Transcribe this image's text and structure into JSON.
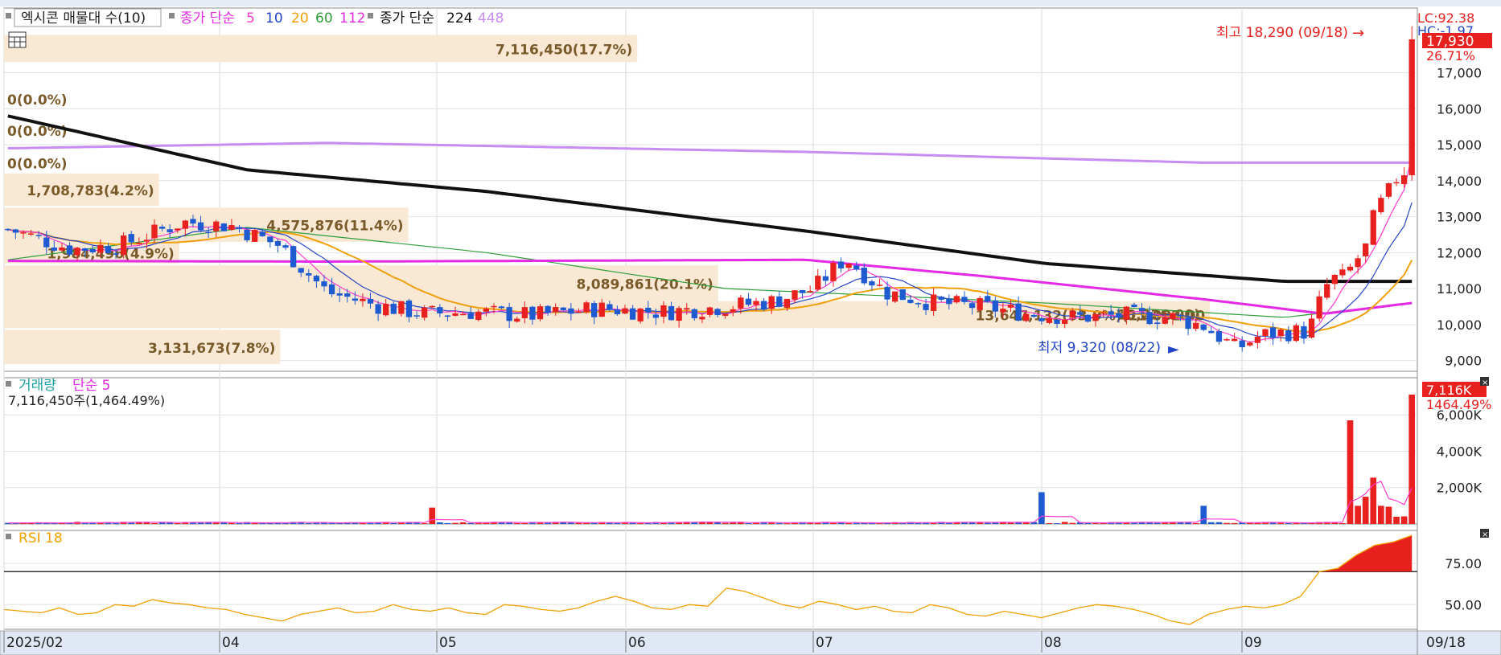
{
  "legend": {
    "main_box": "엑시콘 매물대 수(10)",
    "ma_prefix": "종가 단순",
    "ma_periods": [
      "5",
      "10",
      "20",
      "60",
      "112"
    ],
    "ma_long_prefix": "종가 단순",
    "ma_long_periods": [
      "224",
      "448"
    ],
    "volume_title": "거래량",
    "volume_ma": "단순 5",
    "volume_summary": "7,116,450주(1,464.49%)",
    "rsi_title": "RSI 18"
  },
  "right_labels": {
    "lc": "LC:92.38",
    "hc": "HC:-1.97",
    "last_price": "17,930",
    "change_pct": "26.71%",
    "vol_last": "7,116K",
    "vol_pct": "1464.49%",
    "date_last": "09/18"
  },
  "markers": {
    "high": "최고 18,290 (09/18)",
    "low": "최저 9,320 (08/22)"
  },
  "colors": {
    "up": "#e8201e",
    "down": "#1e5ad0",
    "ma5": "#ff3cd2",
    "ma10": "#2345c8",
    "ma20": "#f0a00a",
    "ma60": "#2e9e3a",
    "ma112": "#e42ae4",
    "ma224": "#111111",
    "ma448": "#c88cf5",
    "profile": "#f8e8d4",
    "profile_text": "#7a5a28",
    "rsi": "#f0a000"
  },
  "chart_data": [
    {
      "type": "candlestick",
      "title": "엑시콘",
      "x_ticks": [
        "2025/02",
        "04",
        "05",
        "06",
        "07",
        "08",
        "09"
      ],
      "ylim": [
        8700,
        18800
      ],
      "y_ticks": [
        9000,
        10000,
        11000,
        12000,
        13000,
        14000,
        15000,
        16000,
        17000
      ],
      "y_tick_labels": [
        "9,000",
        "10,000",
        "11,000",
        "12,000",
        "13,000",
        "14,000",
        "15,000",
        "16,000",
        "17,000"
      ],
      "n_days": 154,
      "key_prices": [
        {
          "day": 0,
          "close": 12650
        },
        {
          "day": 8,
          "close": 12100
        },
        {
          "day": 14,
          "close": 12200
        },
        {
          "day": 22,
          "close": 12850
        },
        {
          "day": 28,
          "close": 12750
        },
        {
          "day": 34,
          "close": 12200
        },
        {
          "day": 40,
          "close": 10900
        },
        {
          "day": 46,
          "close": 10550
        },
        {
          "day": 52,
          "close": 10300
        },
        {
          "day": 58,
          "close": 10350
        },
        {
          "day": 66,
          "close": 10250
        },
        {
          "day": 74,
          "close": 10450
        },
        {
          "day": 82,
          "close": 10350
        },
        {
          "day": 90,
          "close": 10500
        },
        {
          "day": 96,
          "close": 10650
        },
        {
          "day": 101,
          "close": 11000
        },
        {
          "day": 105,
          "close": 11850
        },
        {
          "day": 110,
          "close": 10900
        },
        {
          "day": 116,
          "close": 10600
        },
        {
          "day": 122,
          "close": 10500
        },
        {
          "day": 128,
          "close": 10300
        },
        {
          "day": 134,
          "close": 10200
        },
        {
          "day": 140,
          "close": 10250
        },
        {
          "day": 146,
          "close": 10200
        },
        {
          "day": 150,
          "close": 9950
        },
        {
          "day": 154,
          "close": 9320
        },
        {
          "day": 157,
          "close": 9700
        },
        {
          "day": 160,
          "close": 9780
        },
        {
          "day": 163,
          "close": 9800
        },
        {
          "day": 164,
          "close": 10500
        },
        {
          "day": 165,
          "close": 11000
        },
        {
          "day": 166,
          "close": 11300
        },
        {
          "day": 167,
          "close": 11400
        },
        {
          "day": 168,
          "close": 11500
        },
        {
          "day": 169,
          "close": 11800
        },
        {
          "day": 170,
          "close": 12000
        },
        {
          "day": 171,
          "close": 13000
        },
        {
          "day": 172,
          "close": 13400
        },
        {
          "day": 173,
          "close": 13800
        },
        {
          "day": 174,
          "close": 14000
        },
        {
          "day": 175,
          "close": 14150
        },
        {
          "day": 176,
          "close": 17930
        }
      ],
      "high": 18290,
      "low": 9320,
      "series": [
        {
          "name": "224",
          "values": [
            {
              "day": 0,
              "v": 15800
            },
            {
              "day": 30,
              "v": 14300
            },
            {
              "day": 60,
              "v": 13700
            },
            {
              "day": 100,
              "v": 12600
            },
            {
              "day": 130,
              "v": 11700
            },
            {
              "day": 160,
              "v": 11200
            },
            {
              "day": 176,
              "v": 11200
            }
          ]
        },
        {
          "name": "448",
          "values": [
            {
              "day": 0,
              "v": 14900
            },
            {
              "day": 40,
              "v": 15050
            },
            {
              "day": 100,
              "v": 14800
            },
            {
              "day": 150,
              "v": 14500
            },
            {
              "day": 176,
              "v": 14500
            }
          ]
        },
        {
          "name": "112",
          "values": [
            {
              "day": 0,
              "v": 11770
            },
            {
              "day": 40,
              "v": 11750
            },
            {
              "day": 100,
              "v": 11800
            },
            {
              "day": 122,
              "v": 11350
            },
            {
              "day": 150,
              "v": 10700
            },
            {
              "day": 165,
              "v": 10300
            },
            {
              "day": 176,
              "v": 10600
            }
          ]
        },
        {
          "name": "60",
          "values": [
            {
              "day": 0,
              "v": 11800
            },
            {
              "day": 30,
              "v": 12700
            },
            {
              "day": 60,
              "v": 12000
            },
            {
              "day": 90,
              "v": 11000
            },
            {
              "day": 130,
              "v": 10600
            },
            {
              "day": 160,
              "v": 10200
            },
            {
              "day": 176,
              "v": 10600
            }
          ]
        }
      ],
      "volume_profile": [
        {
          "price_lo": 17300,
          "price_hi": 18050,
          "label": "7,116,450(17.7%)",
          "frac": 0.47
        },
        {
          "price_lo": 16100,
          "price_hi": 16450,
          "label": "0(0.0%)",
          "frac": 0.0
        },
        {
          "price_lo": 15200,
          "price_hi": 15600,
          "label": "0(0.0%)",
          "frac": 0.0
        },
        {
          "price_lo": 14300,
          "price_hi": 14700,
          "label": "0(0.0%)",
          "frac": 0.0
        },
        {
          "price_lo": 13300,
          "price_hi": 14200,
          "label": "1,708,783(4.2%)",
          "frac": 0.115
        },
        {
          "price_lo": 12300,
          "price_hi": 13250,
          "label": "4,575,876(11.4%)",
          "frac": 0.3
        },
        {
          "price_lo": 11700,
          "price_hi": 12300,
          "label": "1,984,496(4.9%)",
          "frac": 0.13
        },
        {
          "price_lo": 10650,
          "price_hi": 11650,
          "label": "8,089,861(20.1%)",
          "frac": 0.53
        },
        {
          "price_lo": 9900,
          "price_hi": 10650,
          "label": "13,647,132(33.9%)(11,082.00",
          "frac": 0.895
        },
        {
          "price_lo": 8900,
          "price_hi": 9850,
          "label": "3,131,673(7.8%)",
          "frac": 0.205
        }
      ],
      "profile_extra_label": "10,226.00)"
    },
    {
      "type": "bar",
      "title": "거래량",
      "ylim": [
        0,
        7600
      ],
      "y_ticks": [
        2000,
        4000,
        6000
      ],
      "y_tick_labels": [
        "2,000K",
        "4,000K",
        "6,000K"
      ],
      "unit": "K",
      "spikes": [
        {
          "day": 55,
          "v": 900
        },
        {
          "day": 134,
          "v": 1750
        },
        {
          "day": 155,
          "v": 1000
        },
        {
          "day": 174,
          "v": 5700
        },
        {
          "day": 175,
          "v": 1000
        },
        {
          "day": 176,
          "v": 1500
        },
        {
          "day": 177,
          "v": 2550
        },
        {
          "day": 178,
          "v": 1000
        },
        {
          "day": 179,
          "v": 950
        },
        {
          "day": 180,
          "v": 400
        },
        {
          "day": 181,
          "v": 420
        },
        {
          "day": 182,
          "v": 7116
        }
      ],
      "base_value": 100
    },
    {
      "type": "line",
      "title": "RSI 18",
      "ylim": [
        35,
        95
      ],
      "y_ticks": [
        50,
        75
      ],
      "y_tick_labels": [
        "50.00",
        "75.00"
      ],
      "threshold": 70,
      "values": [
        47,
        46,
        45,
        48,
        44,
        45,
        50,
        49,
        53,
        51,
        50,
        48,
        47,
        44,
        42,
        40,
        44,
        46,
        48,
        45,
        46,
        50,
        47,
        46,
        48,
        45,
        44,
        50,
        49,
        47,
        46,
        48,
        52,
        55,
        52,
        48,
        47,
        50,
        49,
        60,
        58,
        54,
        50,
        48,
        52,
        50,
        47,
        49,
        46,
        45,
        50,
        48,
        44,
        43,
        46,
        44,
        42,
        45,
        48,
        50,
        49,
        47,
        44,
        40,
        38,
        44,
        47,
        49,
        48,
        50,
        55,
        70,
        72,
        80,
        86,
        88,
        92
      ]
    }
  ]
}
